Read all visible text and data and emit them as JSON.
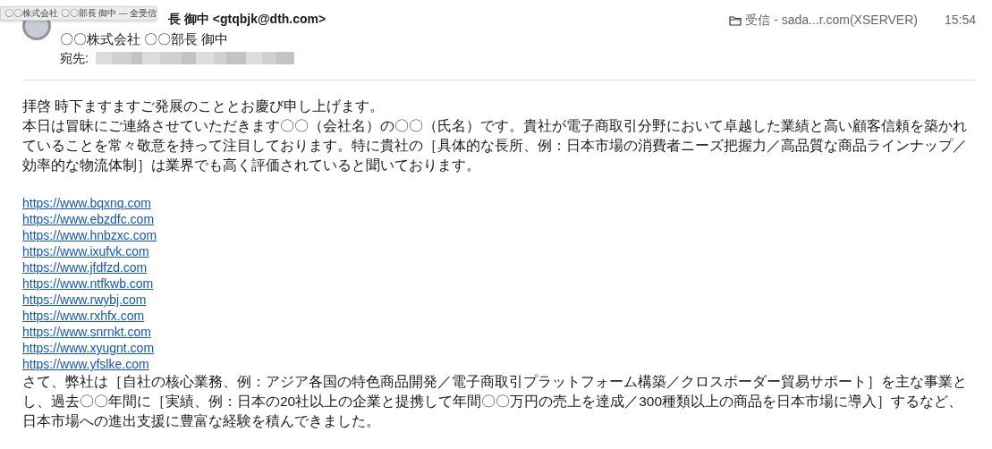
{
  "header": {
    "sender": "長 御中 <gtqbjk@dth.com>",
    "sender_name": "〇〇株式会社 〇〇部長 御中",
    "to_label": "宛先:",
    "mailbox": "受信 - sada...r.com(XSERVER)",
    "time": "15:54",
    "tooltip": "〇〇株式会社 〇〇部長 御中 — 全受信"
  },
  "body": {
    "greeting": "拝啓 時下ますますご発展のこととお慶び申し上げます。",
    "paragraph_1": "本日は冒昧にご連絡させていただきます〇〇（会社名）の〇〇（氏名）です。貴社が電子商取引分野において卓越した業績と高い顧客信頼を築かれていることを常々敬意を持って注目しております。特に貴社の［具体的な長所、例：日本市場の消費者ニーズ把握力／高品質な商品ラインナップ／効率的な物流体制］は業界でも高く評価されていると聞いております。",
    "links": [
      "https://www.bqxnq.com",
      "https://www.ebzdfc.com",
      "https://www.hnbzxc.com",
      "https://www.ixufvk.com",
      "https://www.jfdfzd.com",
      "https://www.ntfkwb.com",
      "https://www.rwybj.com",
      "https://www.rxhfx.com",
      "https://www.snrnkt.com",
      "https://www.xyugnt.com",
      "https://www.yfslke.com"
    ],
    "paragraph_2": "さて、弊社は［自社の核心業務、例：アジア各国の特色商品開発／電子商取引プラットフォーム構築／クロスボーダー貿易サポート］を主な事業とし、過去〇〇年間に［実績、例：日本の20社以上の企業と提携して年間〇〇万円の売上を達成／300種類以上の商品を日本市場に導入］するなど、日本市場への進出支援に豊富な経験を積んできました。"
  }
}
